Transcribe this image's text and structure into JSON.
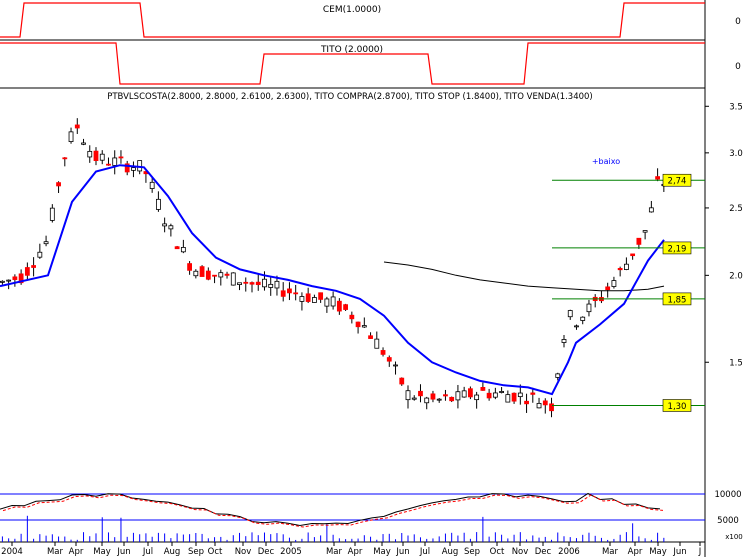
{
  "panels": {
    "cem": {
      "label": "CEM(1.0000)",
      "tick": "0"
    },
    "tito": {
      "label": "TITO (2.0000)",
      "tick": "0"
    },
    "price": {
      "header": "PTBVLSCOSTA(2.8000, 2.8000, 2.6100, 2.6300), TITO COMPRA(2.8700), TITO STOP (1.8400), TITO VENDA(1.3400)",
      "annotation": "+baixo",
      "level_labels": [
        "2,74",
        "2,19",
        "1,85",
        "1,30"
      ],
      "y_ticks": [
        "3.5",
        "3.0",
        "2.5",
        "2.0",
        "1.5"
      ]
    },
    "volume": {
      "y_ticks": [
        "10000",
        "5000"
      ],
      "multiplier": "x100"
    }
  },
  "x_axis_labels": [
    "2004",
    "Mar",
    "Apr",
    "May",
    "Jun",
    "Jul",
    "Aug",
    "Sep",
    "Oct",
    "Nov",
    "Dec",
    "2005",
    "Mar",
    "Apr",
    "May",
    "Jun",
    "Jul",
    "Aug",
    "Sep",
    "Oct",
    "Nov",
    "Dec",
    "2006",
    "Mar",
    "Apr",
    "May",
    "Jun",
    "J"
  ],
  "colors": {
    "up_candle": "#000000",
    "down_candle": "#ff0000",
    "fast_ma": "#0000ff",
    "slow_ma": "#000000",
    "level_lines": "#008000",
    "indicator_line": "#ff0000",
    "label_box": "#ffff00",
    "volume_bars": "#0000ff"
  },
  "chart_data": {
    "type": "candlestick",
    "title": "PTBVLSCOSTA(2.8000, 2.8000, 2.6100, 2.6300), TITO COMPRA(2.8700), TITO STOP (1.8400), TITO VENDA(1.3400)",
    "x_start": "2004-01",
    "x_end": "2006-06",
    "ylim": [
      1.05,
      3.55
    ],
    "y_scale": "log",
    "price_path": [
      [
        "2004-01",
        1.95
      ],
      [
        "2004-02",
        2.0
      ],
      [
        "2004-03",
        2.25
      ],
      [
        "2004-03-20",
        2.95
      ],
      [
        "2004-04-05",
        3.3
      ],
      [
        "2004-04-20",
        3.05
      ],
      [
        "2004-05",
        2.95
      ],
      [
        "2004-06",
        2.9
      ],
      [
        "2004-07",
        2.85
      ],
      [
        "2004-07-20",
        2.5
      ],
      [
        "2004-08",
        2.35
      ],
      [
        "2004-09",
        2.05
      ],
      [
        "2004-10",
        2.0
      ],
      [
        "2004-11",
        1.97
      ],
      [
        "2004-12",
        1.93
      ],
      [
        "2005-01",
        1.9
      ],
      [
        "2005-02",
        1.86
      ],
      [
        "2005-03",
        1.82
      ],
      [
        "2005-04",
        1.72
      ],
      [
        "2005-05",
        1.55
      ],
      [
        "2005-06",
        1.35
      ],
      [
        "2005-07",
        1.32
      ],
      [
        "2005-08",
        1.33
      ],
      [
        "2005-09",
        1.36
      ],
      [
        "2005-10",
        1.35
      ],
      [
        "2005-11",
        1.34
      ],
      [
        "2005-12",
        1.3
      ],
      [
        "2005-12-20",
        1.75
      ],
      [
        "2006-01",
        1.72
      ],
      [
        "2006-02",
        1.85
      ],
      [
        "2006-03",
        2.05
      ],
      [
        "2006-04",
        2.35
      ],
      [
        "2006-04-15",
        2.8
      ],
      [
        "2006-04-25",
        2.63
      ]
    ],
    "fast_moving_average": [
      [
        "2004-01",
        1.93
      ],
      [
        "2004-03",
        2.0
      ],
      [
        "2004-04",
        2.55
      ],
      [
        "2004-05",
        2.82
      ],
      [
        "2004-06",
        2.88
      ],
      [
        "2004-07",
        2.86
      ],
      [
        "2004-08",
        2.6
      ],
      [
        "2004-09",
        2.3
      ],
      [
        "2004-10",
        2.12
      ],
      [
        "2004-11",
        2.04
      ],
      [
        "2004-12",
        2.0
      ],
      [
        "2005-01",
        1.97
      ],
      [
        "2005-02",
        1.93
      ],
      [
        "2005-03",
        1.9
      ],
      [
        "2005-04",
        1.85
      ],
      [
        "2005-05",
        1.75
      ],
      [
        "2005-06",
        1.6
      ],
      [
        "2005-07",
        1.5
      ],
      [
        "2005-08",
        1.45
      ],
      [
        "2005-09",
        1.41
      ],
      [
        "2005-10",
        1.39
      ],
      [
        "2005-11",
        1.38
      ],
      [
        "2005-12",
        1.35
      ],
      [
        "2005-12-20",
        1.5
      ],
      [
        "2006-01",
        1.6
      ],
      [
        "2006-02",
        1.7
      ],
      [
        "2006-03",
        1.82
      ],
      [
        "2006-04",
        2.1
      ],
      [
        "2006-04-20",
        2.25
      ]
    ],
    "slow_moving_average": [
      [
        "2005-05",
        2.09
      ],
      [
        "2005-06",
        2.07
      ],
      [
        "2005-07",
        2.04
      ],
      [
        "2005-08",
        2.0
      ],
      [
        "2005-09",
        1.97
      ],
      [
        "2005-10",
        1.95
      ],
      [
        "2005-11",
        1.93
      ],
      [
        "2005-12",
        1.92
      ],
      [
        "2006-01",
        1.91
      ],
      [
        "2006-02",
        1.9
      ],
      [
        "2006-03",
        1.9
      ],
      [
        "2006-04",
        1.91
      ],
      [
        "2006-04-20",
        1.93
      ]
    ],
    "horizontal_levels": [
      {
        "label": "2,74",
        "value": 2.74,
        "from": "2005-12"
      },
      {
        "label": "2,19",
        "value": 2.19,
        "from": "2005-12"
      },
      {
        "label": "1,85",
        "value": 1.85,
        "from": "2005-12"
      },
      {
        "label": "1,30",
        "value": 1.3,
        "from": "2005-12"
      }
    ],
    "y_ticks": [
      3.5,
      3.0,
      2.5,
      2.0,
      1.5
    ],
    "volume": {
      "unit": "x100",
      "y_ticks": [
        10000,
        5000
      ]
    },
    "cem_signal": [
      [
        "2004-01",
        0
      ],
      [
        "2004-02",
        1
      ],
      [
        "2004-06",
        1
      ],
      [
        "2004-07",
        0
      ],
      [
        "2006-02",
        0
      ],
      [
        "2006-03",
        1
      ],
      [
        "2006-05",
        1
      ]
    ],
    "tito_signal": [
      [
        "2004-01",
        1
      ],
      [
        "2004-05",
        1
      ],
      [
        "2004-06",
        -1
      ],
      [
        "2004-11",
        -1
      ],
      [
        "2004-12",
        0
      ],
      [
        "2005-02",
        0
      ],
      [
        "2005-06",
        0
      ],
      [
        "2005-07",
        -1
      ],
      [
        "2005-10",
        -1
      ],
      [
        "2005-11",
        1
      ],
      [
        "2006-05",
        1
      ]
    ],
    "grid": false
  }
}
